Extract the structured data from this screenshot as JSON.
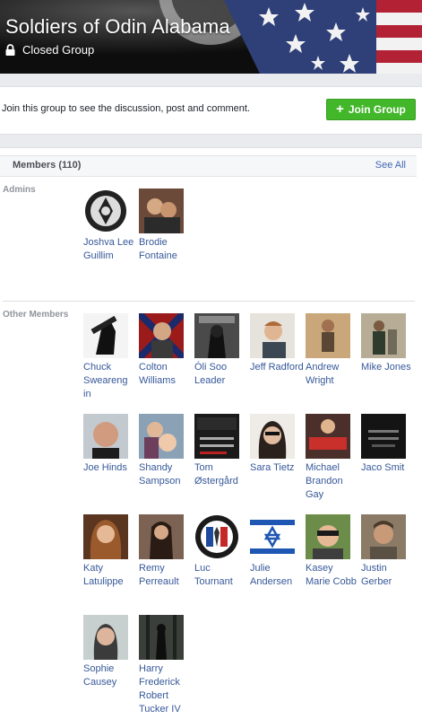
{
  "group": {
    "name": "Soldiers of Odin Alabama",
    "privacy": "Closed Group"
  },
  "join_bar": {
    "message": "Join this group to see the discussion, post and comment.",
    "button_label": "Join Group",
    "button_icon": "+"
  },
  "members": {
    "header": "Members (110)",
    "see_all": "See All",
    "admins_label": "Admins",
    "others_label": "Other Members",
    "admins": [
      {
        "name": "Joshva Lee Guillim"
      },
      {
        "name": "Brodie Fontaine"
      }
    ],
    "others": [
      {
        "name": "Chuck Sweareng in"
      },
      {
        "name": "Colton Williams"
      },
      {
        "name": "Óli Soo Leader"
      },
      {
        "name": "Jeff Radford"
      },
      {
        "name": "Andrew Wright"
      },
      {
        "name": "Mike Jones"
      },
      {
        "name": "Joe Hinds"
      },
      {
        "name": "Shandy Sampson"
      },
      {
        "name": "Tom Østergård"
      },
      {
        "name": "Sara Tietz"
      },
      {
        "name": "Michael Brandon Gay"
      },
      {
        "name": "Jaco Smit"
      },
      {
        "name": "Katy Latulippe"
      },
      {
        "name": "Remy Perreault"
      },
      {
        "name": "Luc Tournant"
      },
      {
        "name": "Julie Andersen"
      },
      {
        "name": "Kasey Marie Cobb"
      },
      {
        "name": "Justin Gerber"
      },
      {
        "name": "Sophie Causey"
      },
      {
        "name": "Harry Frederick Robert Tucker IV"
      }
    ]
  },
  "colors": {
    "join_green": "#42b72a",
    "link_blue": "#365899",
    "page_bg": "#e9ebee"
  }
}
